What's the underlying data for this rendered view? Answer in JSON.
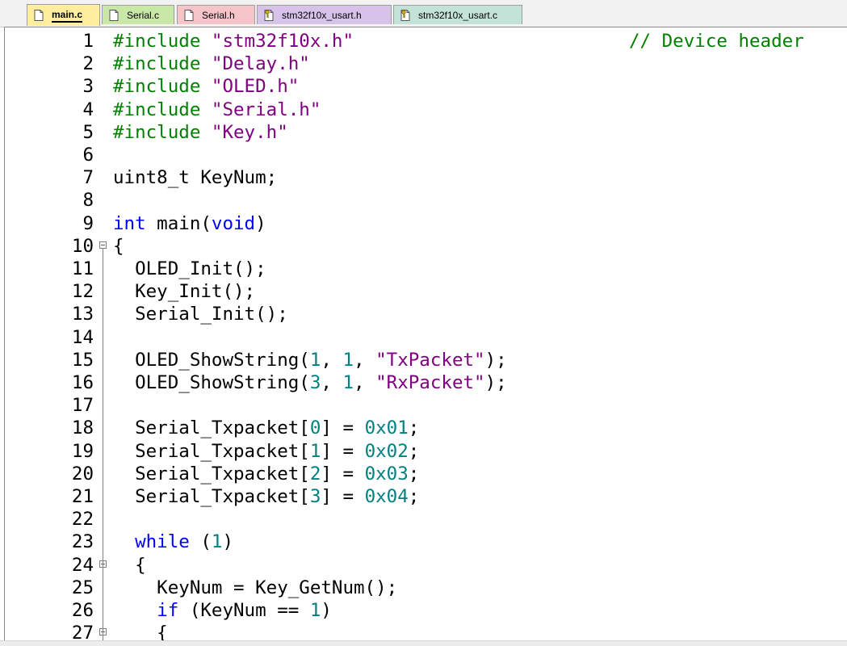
{
  "tabs": [
    {
      "label": "main.c",
      "active": true,
      "bg": "#ffee9c",
      "icon": "file-icon"
    },
    {
      "label": "Serial.c",
      "active": false,
      "bg": "#c9e7a7",
      "icon": "file-icon"
    },
    {
      "label": "Serial.h",
      "active": false,
      "bg": "#f5c5c9",
      "icon": "file-icon"
    },
    {
      "label": "stm32f10x_usart.h",
      "active": false,
      "bg": "#d7c3ea",
      "icon": "file-key-icon"
    },
    {
      "label": "stm32f10x_usart.c",
      "active": false,
      "bg": "#c4e3d8",
      "icon": "file-key-icon"
    }
  ],
  "colors": {
    "preprocessor": "#008000",
    "string": "#800080",
    "keyword": "#0000ff",
    "number": "#008080",
    "comment": "#008000"
  },
  "editor": {
    "lines": [
      {
        "n": "1",
        "fold": false,
        "tokens": [
          {
            "t": "#include ",
            "c": "pre"
          },
          {
            "t": "\"stm32f10x.h\"",
            "c": "str"
          }
        ],
        "comment": "// Device header"
      },
      {
        "n": "2",
        "fold": false,
        "tokens": [
          {
            "t": "#include ",
            "c": "pre"
          },
          {
            "t": "\"Delay.h\"",
            "c": "str"
          }
        ]
      },
      {
        "n": "3",
        "fold": false,
        "tokens": [
          {
            "t": "#include ",
            "c": "pre"
          },
          {
            "t": "\"OLED.h\"",
            "c": "str"
          }
        ]
      },
      {
        "n": "4",
        "fold": false,
        "tokens": [
          {
            "t": "#include ",
            "c": "pre"
          },
          {
            "t": "\"Serial.h\"",
            "c": "str"
          }
        ]
      },
      {
        "n": "5",
        "fold": false,
        "tokens": [
          {
            "t": "#include ",
            "c": "pre"
          },
          {
            "t": "\"Key.h\"",
            "c": "str"
          }
        ]
      },
      {
        "n": "6",
        "fold": false,
        "tokens": []
      },
      {
        "n": "7",
        "fold": false,
        "tokens": [
          {
            "t": "uint8_t KeyNum;",
            "c": "id"
          }
        ]
      },
      {
        "n": "8",
        "fold": false,
        "tokens": []
      },
      {
        "n": "9",
        "fold": false,
        "tokens": [
          {
            "t": "int",
            "c": "kw"
          },
          {
            "t": " main(",
            "c": "id"
          },
          {
            "t": "void",
            "c": "kw"
          },
          {
            "t": ")",
            "c": "id"
          }
        ]
      },
      {
        "n": "10",
        "fold": true,
        "tokens": [
          {
            "t": "{",
            "c": "id"
          }
        ]
      },
      {
        "n": "11",
        "fold": false,
        "tokens": [
          {
            "t": "  OLED_Init();",
            "c": "id"
          }
        ]
      },
      {
        "n": "12",
        "fold": false,
        "tokens": [
          {
            "t": "  Key_Init();",
            "c": "id"
          }
        ]
      },
      {
        "n": "13",
        "fold": false,
        "tokens": [
          {
            "t": "  Serial_Init();",
            "c": "id"
          }
        ]
      },
      {
        "n": "14",
        "fold": false,
        "tokens": []
      },
      {
        "n": "15",
        "fold": false,
        "tokens": [
          {
            "t": "  OLED_ShowString(",
            "c": "id"
          },
          {
            "t": "1",
            "c": "num"
          },
          {
            "t": ", ",
            "c": "id"
          },
          {
            "t": "1",
            "c": "num"
          },
          {
            "t": ", ",
            "c": "id"
          },
          {
            "t": "\"TxPacket\"",
            "c": "str"
          },
          {
            "t": ");",
            "c": "id"
          }
        ]
      },
      {
        "n": "16",
        "fold": false,
        "tokens": [
          {
            "t": "  OLED_ShowString(",
            "c": "id"
          },
          {
            "t": "3",
            "c": "num"
          },
          {
            "t": ", ",
            "c": "id"
          },
          {
            "t": "1",
            "c": "num"
          },
          {
            "t": ", ",
            "c": "id"
          },
          {
            "t": "\"RxPacket\"",
            "c": "str"
          },
          {
            "t": ");",
            "c": "id"
          }
        ]
      },
      {
        "n": "17",
        "fold": false,
        "tokens": []
      },
      {
        "n": "18",
        "fold": false,
        "tokens": [
          {
            "t": "  Serial_Txpacket[",
            "c": "id"
          },
          {
            "t": "0",
            "c": "num"
          },
          {
            "t": "] = ",
            "c": "id"
          },
          {
            "t": "0x01",
            "c": "num"
          },
          {
            "t": ";",
            "c": "id"
          }
        ]
      },
      {
        "n": "19",
        "fold": false,
        "tokens": [
          {
            "t": "  Serial_Txpacket[",
            "c": "id"
          },
          {
            "t": "1",
            "c": "num"
          },
          {
            "t": "] = ",
            "c": "id"
          },
          {
            "t": "0x02",
            "c": "num"
          },
          {
            "t": ";",
            "c": "id"
          }
        ]
      },
      {
        "n": "20",
        "fold": false,
        "tokens": [
          {
            "t": "  Serial_Txpacket[",
            "c": "id"
          },
          {
            "t": "2",
            "c": "num"
          },
          {
            "t": "] = ",
            "c": "id"
          },
          {
            "t": "0x03",
            "c": "num"
          },
          {
            "t": ";",
            "c": "id"
          }
        ]
      },
      {
        "n": "21",
        "fold": false,
        "tokens": [
          {
            "t": "  Serial_Txpacket[",
            "c": "id"
          },
          {
            "t": "3",
            "c": "num"
          },
          {
            "t": "] = ",
            "c": "id"
          },
          {
            "t": "0x04",
            "c": "num"
          },
          {
            "t": ";",
            "c": "id"
          }
        ]
      },
      {
        "n": "22",
        "fold": false,
        "tokens": []
      },
      {
        "n": "23",
        "fold": false,
        "tokens": [
          {
            "t": "  ",
            "c": "id"
          },
          {
            "t": "while",
            "c": "kw"
          },
          {
            "t": " (",
            "c": "id"
          },
          {
            "t": "1",
            "c": "num"
          },
          {
            "t": ")",
            "c": "id"
          }
        ]
      },
      {
        "n": "24",
        "fold": true,
        "tokens": [
          {
            "t": "  {",
            "c": "id"
          }
        ]
      },
      {
        "n": "25",
        "fold": false,
        "tokens": [
          {
            "t": "    KeyNum = Key_GetNum();",
            "c": "id"
          }
        ]
      },
      {
        "n": "26",
        "fold": false,
        "tokens": [
          {
            "t": "    ",
            "c": "id"
          },
          {
            "t": "if",
            "c": "kw"
          },
          {
            "t": " (KeyNum == ",
            "c": "id"
          },
          {
            "t": "1",
            "c": "num"
          },
          {
            "t": ")",
            "c": "id"
          }
        ]
      },
      {
        "n": "27",
        "fold": true,
        "tokens": [
          {
            "t": "    {",
            "c": "id"
          }
        ]
      }
    ]
  }
}
